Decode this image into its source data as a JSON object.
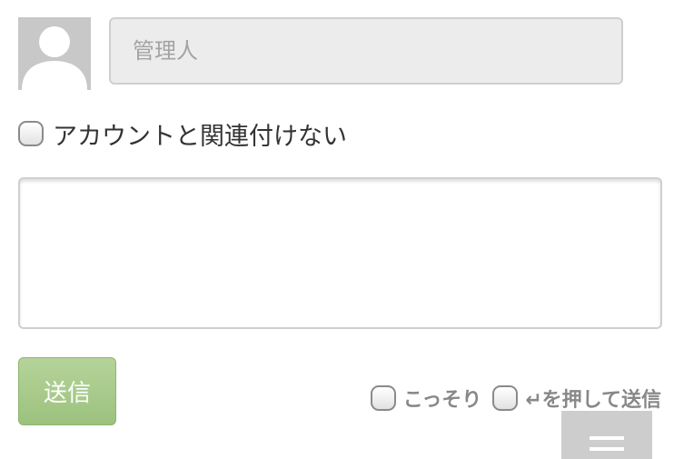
{
  "comment_form": {
    "name_placeholder": "管理人",
    "anonymous_label": "アカウントと関連付けない",
    "message_value": "",
    "send_label": "送信",
    "secret_label": "こっそり",
    "enter_send_label": "↵を押して送信"
  },
  "icons": {
    "avatar": "default-user-avatar-icon",
    "menu": "hamburger-menu-icon"
  },
  "colors": {
    "send_button": "#a8cb8a",
    "avatar_bg": "#c8c8c8",
    "menu_bg": "#cdcdcd"
  }
}
